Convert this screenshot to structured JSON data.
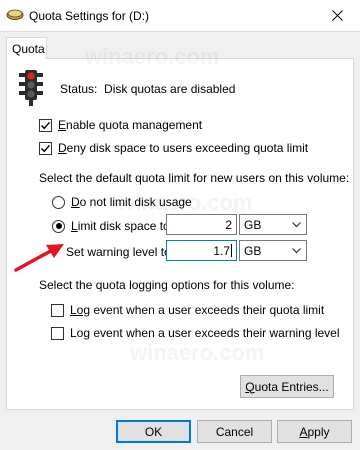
{
  "window": {
    "title": "Quota Settings for  (D:)",
    "close_icon": "close-icon"
  },
  "tabs": [
    {
      "label": "Quota",
      "active": true
    }
  ],
  "status": {
    "text": "Status:  Disk quotas are disabled",
    "icon": "traffic-light-icon"
  },
  "checkboxes": {
    "enable_quota": {
      "label_first": "E",
      "label_rest": "nable quota management",
      "checked": true
    },
    "deny_space": {
      "label_first": "D",
      "label_rest": "eny disk space to users exceeding quota limit",
      "checked": true
    }
  },
  "default_limit": {
    "heading": "Select the default quota limit for new users on this volume:",
    "no_limit": {
      "label_first": "D",
      "label_rest": "o not limit disk usage",
      "selected": false
    },
    "limit": {
      "label_first": "L",
      "label_rest": "imit disk space to",
      "selected": true,
      "value": "2",
      "unit": "GB"
    },
    "warning": {
      "label": "Set warning level to",
      "value": "1.7",
      "unit": "GB"
    }
  },
  "logging": {
    "heading": "Select the quota logging options for this volume:",
    "log_limit": {
      "label_pre": "Log",
      "label_post": " event when a user exceeds their quota limit",
      "checked": false
    },
    "log_warning": {
      "label_pre": "Lo",
      "label_mid": "g",
      "label_post": " event when a user exceeds their warning level",
      "checked": false
    }
  },
  "buttons": {
    "quota_entries": {
      "label_first": "Q",
      "label_rest": "uota Entries..."
    },
    "ok": "OK",
    "cancel": "Cancel",
    "apply_first": "A",
    "apply_rest": "pply"
  },
  "watermark_text": "winaero.com",
  "colors": {
    "accent": "#0078d7",
    "arrow": "#e81123",
    "dialog_bg": "#f0f0f0"
  }
}
